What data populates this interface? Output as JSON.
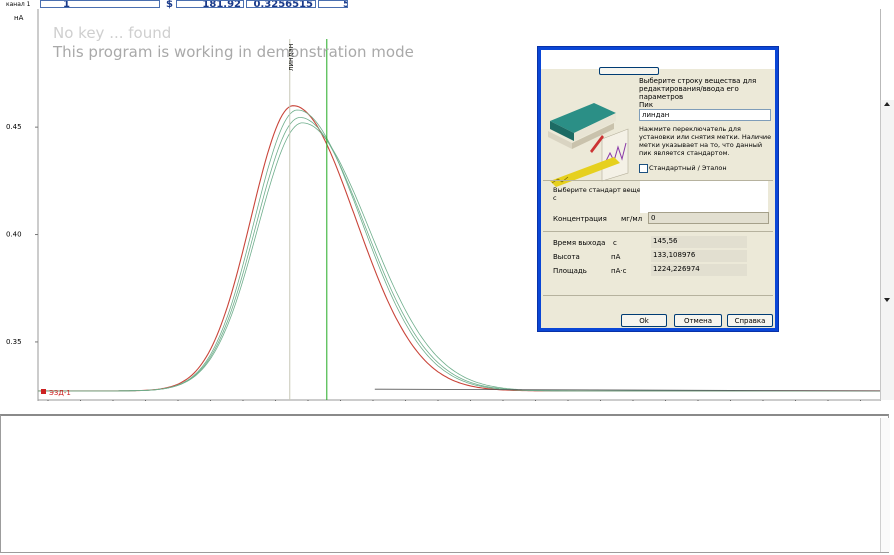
{
  "toolbar": {
    "channel_label": "канал 1",
    "channel_value": "1",
    "marker": "$",
    "cell_time": "181,92",
    "cell_value": "0,3256515",
    "cell_extra": "5"
  },
  "watermark": {
    "line1": "No key ... found",
    "line2": "This program is working in demonstration mode"
  },
  "peak_label": "линдан",
  "legend_label": "ЭЗД-1",
  "colors": {
    "curve_main": "#c9453a",
    "curve_secondary": "#6fae8c",
    "marker_line": "#22aa22",
    "accent_titlebar": "#0a46d6"
  },
  "chart_data": {
    "type": "line",
    "ylabel": "нА",
    "yticks": [
      "0.45",
      "0.40",
      "0.35"
    ],
    "ylim": [
      0.3225,
      0.505
    ],
    "xlim": [
      0,
      100
    ],
    "grid": false,
    "marker_x": 34.3,
    "peak_x_line": 29.9,
    "series": [
      {
        "color": "#c9453a",
        "baseline": 0.3272,
        "peak": 0.46,
        "center": 30.3,
        "sigma_left": 5.0,
        "sigma_right": 7.4
      },
      {
        "color": "#6fae8c",
        "baseline": 0.3272,
        "peak": 0.458,
        "center": 30.8,
        "sigma_left": 5.1,
        "sigma_right": 7.6
      },
      {
        "color": "#6fae8c",
        "baseline": 0.3272,
        "peak": 0.4545,
        "center": 31.1,
        "sigma_left": 5.2,
        "sigma_right": 7.7
      },
      {
        "color": "#6fae8c",
        "baseline": 0.3272,
        "peak": 0.452,
        "center": 31.4,
        "sigma_left": 5.3,
        "sigma_right": 7.9
      }
    ]
  },
  "dialog": {
    "top_button": "",
    "instruction": "Выберите строку вещества для редактирования/ввода его параметров",
    "substance_label": "Пик",
    "substance_value": "линдан",
    "hint": "Нажмите переключатель для установки или снятия метки. Наличие метки указывает на то, что данный пик является стандартом.",
    "checkbox_label": "Стандартный / Эталон",
    "choose_label": "Выберите стандарт вещества",
    "choose_suffix": "с",
    "conc_label": "Концентрация",
    "conc_unit": "мг/мл",
    "conc_value": "0",
    "rt_label": "Время выхода",
    "rt_unit": "с",
    "rt_value": "145,56",
    "height_label": "Высота",
    "height_unit": "пА",
    "height_value": "133,108976",
    "area_label": "Площадь",
    "area_unit": "пА·с",
    "area_value": "1224,226974",
    "ok_button": "Ok",
    "cancel_button": "Отмена",
    "help_button": "Справка"
  }
}
